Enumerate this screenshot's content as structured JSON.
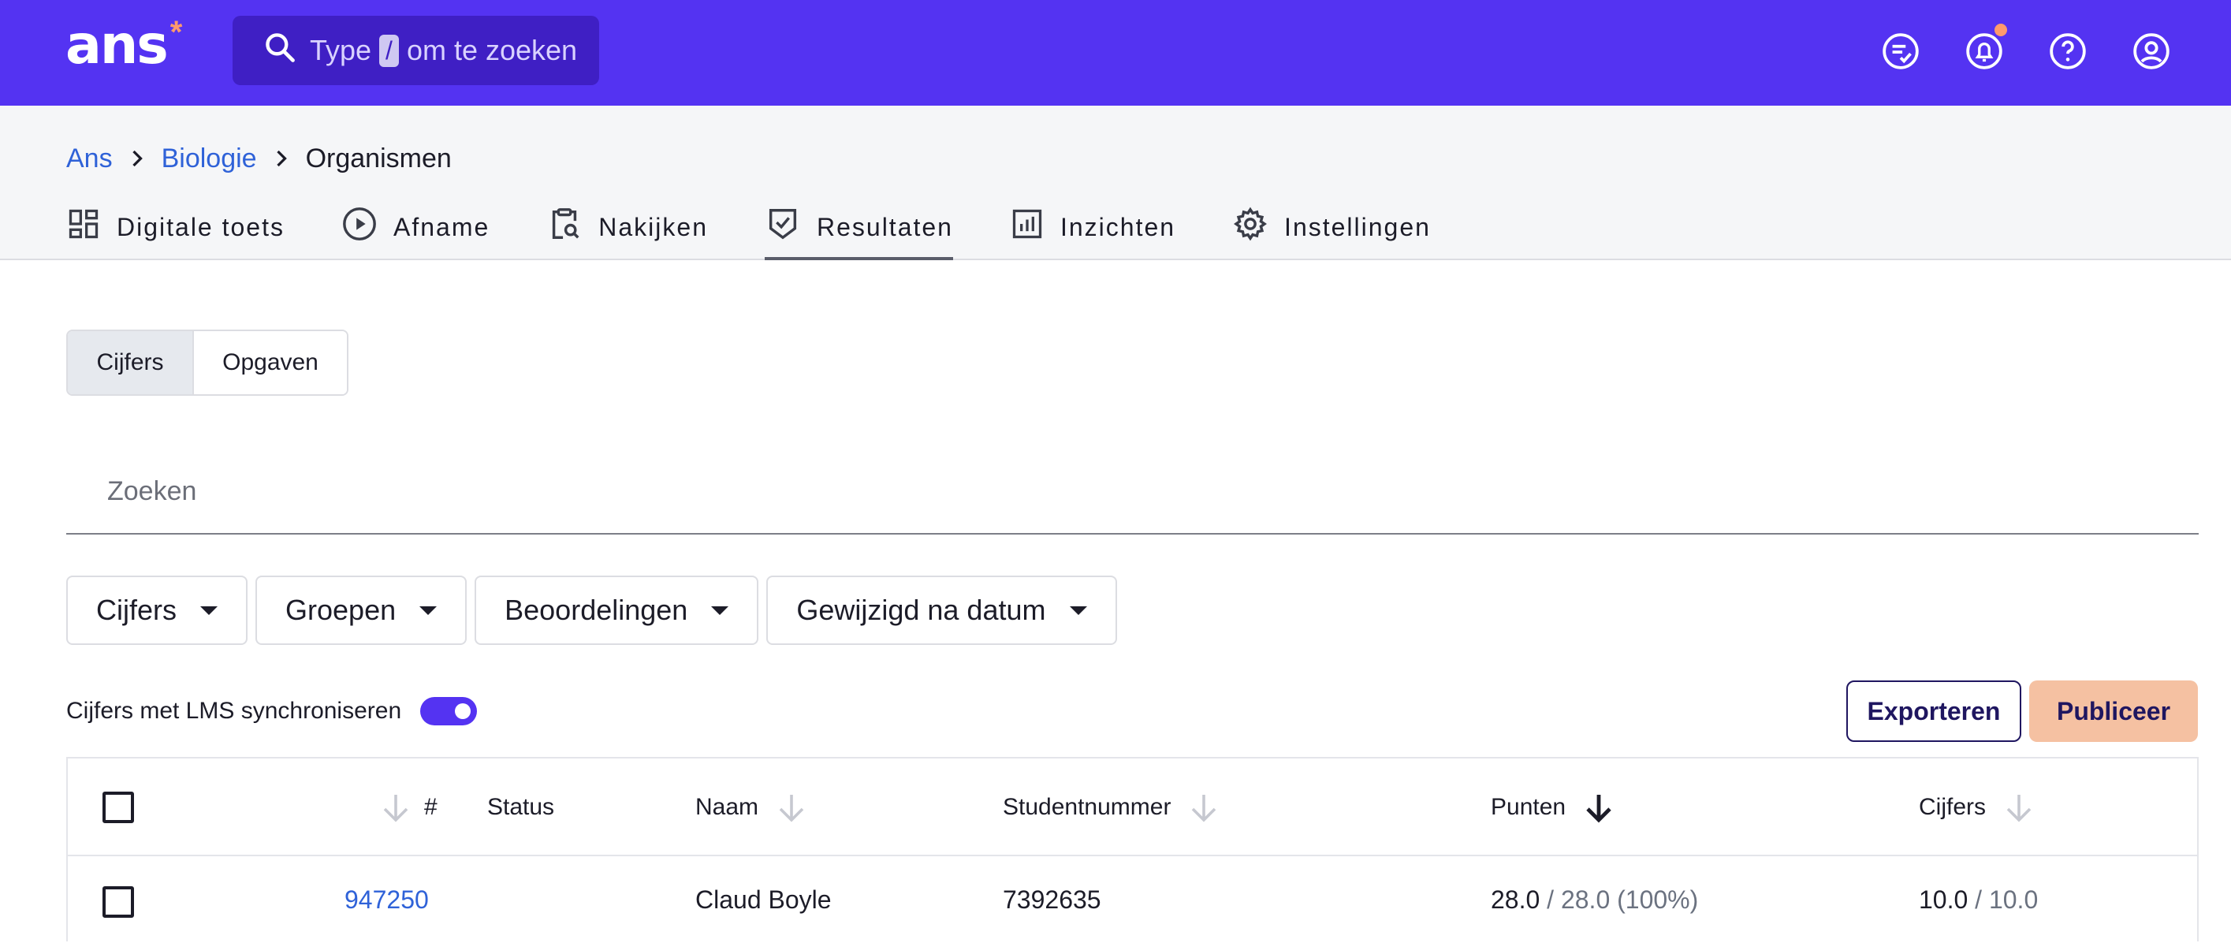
{
  "app": {
    "logo_text": "ans",
    "logo_mark": "*",
    "brand_color": "#5433f2",
    "accent_color": "#ff9a6c"
  },
  "search": {
    "prefix": "Type",
    "key": "/",
    "suffix": "om te zoeken",
    "icon": "search-icon"
  },
  "topbar_icons": [
    "tasks-icon",
    "bell-icon",
    "help-icon",
    "account-icon"
  ],
  "breadcrumb": [
    {
      "label": "Ans"
    },
    {
      "label": "Biologie"
    },
    {
      "label": "Organismen"
    }
  ],
  "tabs": [
    {
      "label": "Digitale toets",
      "icon": "dashboard-icon"
    },
    {
      "label": "Afname",
      "icon": "play-icon"
    },
    {
      "label": "Nakijken",
      "icon": "clipboard-search-icon"
    },
    {
      "label": "Resultaten",
      "icon": "shield-check-icon",
      "active": true
    },
    {
      "label": "Inzichten",
      "icon": "bar-chart-icon"
    },
    {
      "label": "Instellingen",
      "icon": "gear-icon"
    }
  ],
  "segment": {
    "options": [
      "Cijfers",
      "Opgaven"
    ],
    "selected": "Cijfers"
  },
  "list_search": {
    "placeholder": "Zoeken"
  },
  "filters": [
    "Cijfers",
    "Groepen",
    "Beoordelingen",
    "Gewijzigd na datum"
  ],
  "lms": {
    "label": "Cijfers met LMS synchroniseren",
    "enabled": true
  },
  "actions": {
    "export_label": "Exporteren",
    "publish_label": "Publiceer"
  },
  "table": {
    "columns": [
      "#",
      "Status",
      "Naam",
      "Studentnummer",
      "Punten",
      "Cijfers"
    ],
    "sorted_column": "Punten",
    "rows": [
      {
        "id": "947250",
        "status": "",
        "name": "Claud Boyle",
        "student_number": "7392635",
        "points": "28.0",
        "points_max": "/ 28.0 (100%)",
        "grade": "10.0",
        "grade_max": "/ 10.0"
      }
    ]
  }
}
